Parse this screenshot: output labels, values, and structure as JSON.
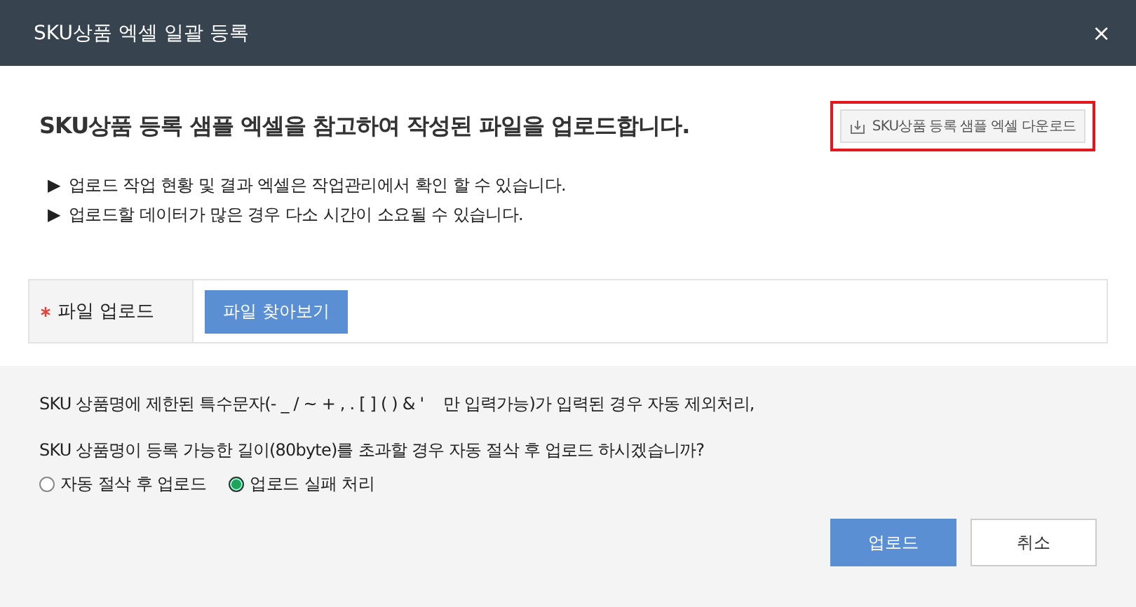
{
  "window": {
    "title": "SKU상품 엑셀 일괄 등록",
    "close": "×"
  },
  "heading": "SKU상품 등록 샘플 엑셀을 참고하여 작성된 파일을 업로드합니다.",
  "download_button": {
    "label": "SKU상품 등록 샘플 엑셀 다운로드",
    "highlighted": true
  },
  "notes": [
    {
      "marker": "▶",
      "text": "업로드 작업 현황 및 결과 엑셀은 작업관리에서 확인 할 수 있습니다."
    },
    {
      "marker": "▶",
      "text": "업로드할 데이터가 많은 경우 다소 시간이 소요될 수 있습니다."
    }
  ],
  "form": {
    "label": "파일 업로드",
    "required": true,
    "button": "파일 찾아보기"
  },
  "messages": [
    "SKU 상품명에 제한된 특수문자(- _ / ~ + , . [ ] ( ) & '    만 입력가능)가 입력된 경우 자동 제외처리,",
    "SKU 상품명이 등록 가능한 길이(80byte)를 초과할 경우 자동 절삭 후 업로드 하시겠습니까?"
  ],
  "options": [
    {
      "label": "자동 절삭 후 업로드",
      "selected": false
    },
    {
      "label": "업로드 실패 처리",
      "selected": true
    }
  ],
  "buttons": [
    {
      "label": "업로드",
      "kind": "primary"
    },
    {
      "label": "취소",
      "kind": "secondary"
    }
  ]
}
